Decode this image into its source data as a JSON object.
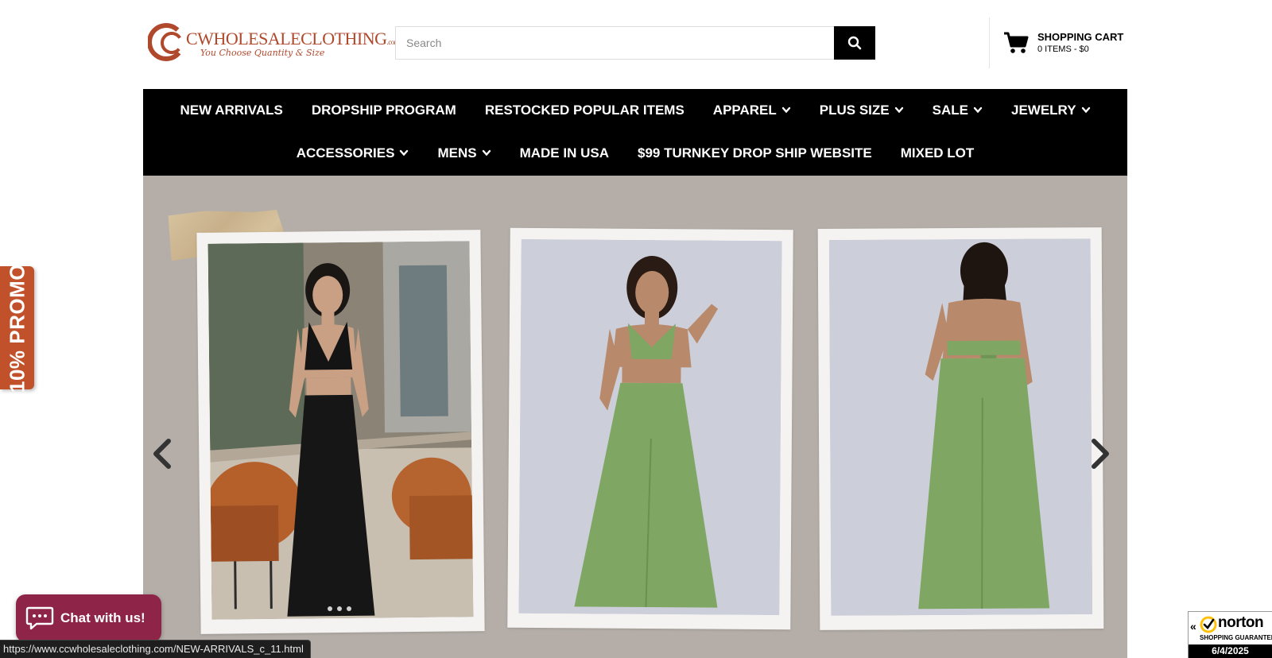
{
  "header": {
    "logo_text": "CWHOLESALECLOTHING",
    "logo_suffix": ".com",
    "logo_tagline": "You Choose Quantity & Size",
    "search": {
      "placeholder": "Search",
      "button_icon": "search-icon"
    },
    "cart": {
      "title": "SHOPPING CART",
      "summary": "0 ITEMS - $0",
      "icon": "cart-icon"
    }
  },
  "nav": {
    "row1": [
      {
        "label": "NEW ARRIVALS",
        "dropdown": false
      },
      {
        "label": "DROPSHIP PROGRAM",
        "dropdown": false
      },
      {
        "label": "RESTOCKED POPULAR ITEMS",
        "dropdown": false
      },
      {
        "label": "APPAREL",
        "dropdown": true
      },
      {
        "label": "PLUS SIZE",
        "dropdown": true
      },
      {
        "label": "SALE",
        "dropdown": true
      },
      {
        "label": "JEWELRY",
        "dropdown": true
      }
    ],
    "row2": [
      {
        "label": "ACCESSORIES",
        "dropdown": true
      },
      {
        "label": "MENS",
        "dropdown": true
      },
      {
        "label": "MADE IN USA",
        "dropdown": false
      },
      {
        "label": "$99 TURNKEY DROP SHIP WEBSITE",
        "dropdown": false
      },
      {
        "label": "MIXED LOT",
        "dropdown": false
      }
    ]
  },
  "hero": {
    "background": "#b5aea8",
    "slides": [
      {
        "outfit_color": "#161616",
        "backdrop": "restaurant-interior"
      },
      {
        "outfit_color": "#7fa663",
        "backdrop": "#ccced9"
      },
      {
        "outfit_color": "#7fa663",
        "backdrop": "#ccced9"
      }
    ],
    "prev_icon": "chevron-left-icon",
    "next_icon": "chevron-right-icon"
  },
  "promo": {
    "label": "10% PROMO",
    "color": "#c0512b"
  },
  "chat": {
    "label": "Chat with us!",
    "color": "#8e2448",
    "icon": "chat-bubble-icon"
  },
  "status_bar": {
    "url": "https://www.ccwholesaleclothing.com/NEW-ARRIVALS_c_11.html"
  },
  "norton": {
    "brand": "norton",
    "subtitle": "SHOPPING GUARANTEE",
    "date": "6/4/2025"
  }
}
